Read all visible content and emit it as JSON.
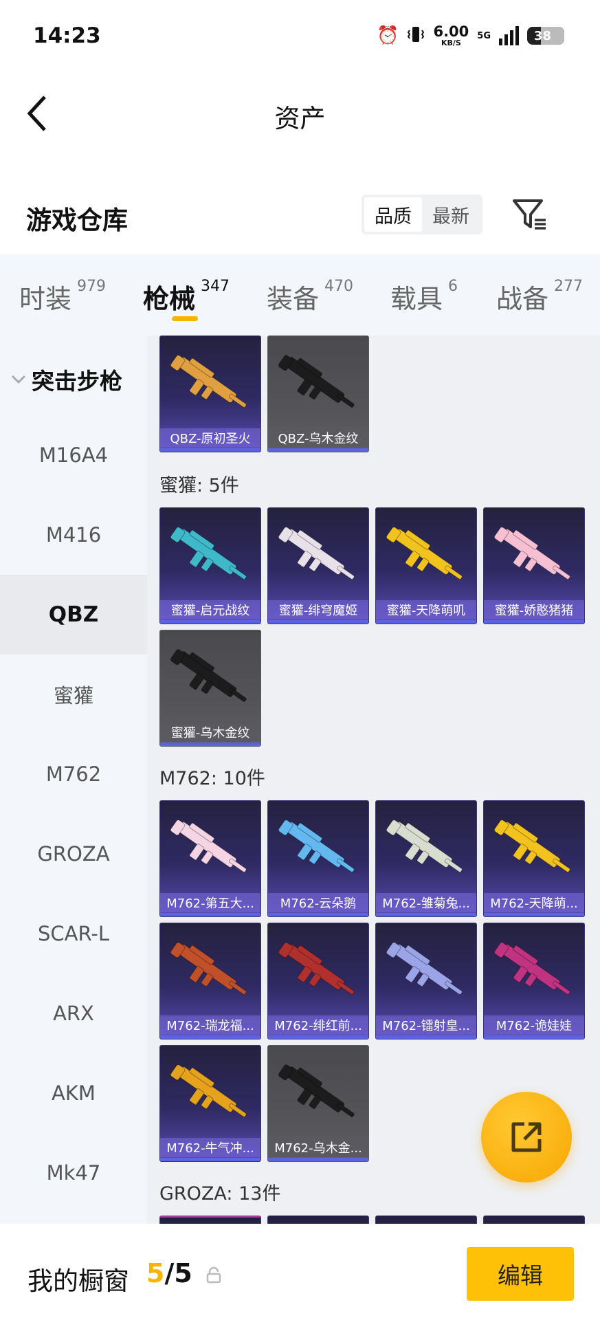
{
  "status_bar": {
    "time": "14:23",
    "net_speed": "6.00",
    "net_unit": "KB/S",
    "network": "5G",
    "battery": "38",
    "icons": [
      "alarm-icon",
      "vibrate-icon",
      "network-5g-icon",
      "signal-icon",
      "battery-icon"
    ]
  },
  "header": {
    "title": "资产",
    "back_icon": "chevron-left-icon"
  },
  "section": {
    "title": "游戏仓库",
    "sort_options": [
      "品质",
      "最新"
    ],
    "sort_selected": "品质",
    "filter_icon": "filter-icon"
  },
  "tabs": [
    {
      "label": "时装",
      "count": "979",
      "active": false
    },
    {
      "label": "枪械",
      "count": "347",
      "active": true
    },
    {
      "label": "装备",
      "count": "470",
      "active": false
    },
    {
      "label": "载具",
      "count": "6",
      "active": false
    },
    {
      "label": "战备",
      "count": "277",
      "active": false
    }
  ],
  "sidebar": {
    "group": "突击步枪",
    "items": [
      {
        "label": "M16A4",
        "active": false
      },
      {
        "label": "M416",
        "active": false
      },
      {
        "label": "QBZ",
        "active": true
      },
      {
        "label": "蜜獾",
        "active": false
      },
      {
        "label": "M762",
        "active": false
      },
      {
        "label": "GROZA",
        "active": false
      },
      {
        "label": "SCAR-L",
        "active": false
      },
      {
        "label": "ARX",
        "active": false
      },
      {
        "label": "AKM",
        "active": false
      },
      {
        "label": "Mk47",
        "active": false
      }
    ]
  },
  "groups": [
    {
      "label": "",
      "items": [
        {
          "name": "QBZ-原初圣火",
          "style": "purple",
          "color": "#e0a040"
        },
        {
          "name": "QBZ-乌木金纹",
          "style": "gray",
          "color": "#1c1c1c"
        }
      ]
    },
    {
      "label": "蜜獾: 5件",
      "items": [
        {
          "name": "蜜獾-启元战纹",
          "style": "purple",
          "color": "#3fb9c9"
        },
        {
          "name": "蜜獾-绯穹魔姬",
          "style": "purple",
          "color": "#e9e1ea"
        },
        {
          "name": "蜜獾-天降萌叽",
          "style": "purple",
          "color": "#f2c21e"
        },
        {
          "name": "蜜獾-娇憨猪猪",
          "style": "purple",
          "color": "#f6bfd2"
        },
        {
          "name": "蜜獾-乌木金纹",
          "style": "gray",
          "color": "#1c1c1c"
        }
      ]
    },
    {
      "label": "M762: 10件",
      "items": [
        {
          "name": "M762-第五大...",
          "style": "purple",
          "color": "#f5d4e4"
        },
        {
          "name": "M762-云朵鹅",
          "style": "purple",
          "color": "#62b8ef"
        },
        {
          "name": "M762-雏菊兔...",
          "style": "purple",
          "color": "#d8ddd0"
        },
        {
          "name": "M762-天降萌...",
          "style": "purple",
          "color": "#f2c21e"
        },
        {
          "name": "M762-瑞龙福...",
          "style": "purple",
          "color": "#c0502a"
        },
        {
          "name": "M762-绯红前...",
          "style": "purple",
          "color": "#b0302e"
        },
        {
          "name": "M762-镭射皇...",
          "style": "purple",
          "color": "#9aa4e6"
        },
        {
          "name": "M762-诡娃娃",
          "style": "purple",
          "color": "#c03380"
        },
        {
          "name": "M762-牛气冲...",
          "style": "purple",
          "color": "#e5a21d"
        },
        {
          "name": "M762-乌木金...",
          "style": "gray",
          "color": "#1c1c1c"
        }
      ]
    },
    {
      "label": "GROZA: 13件",
      "items": []
    }
  ],
  "fab": {
    "icon": "share-external-icon"
  },
  "bottom": {
    "label": "我的橱窗",
    "count_current": "5",
    "count_sep": "/",
    "count_total": "5",
    "lock_icon": "lock-icon",
    "edit_label": "编辑"
  }
}
